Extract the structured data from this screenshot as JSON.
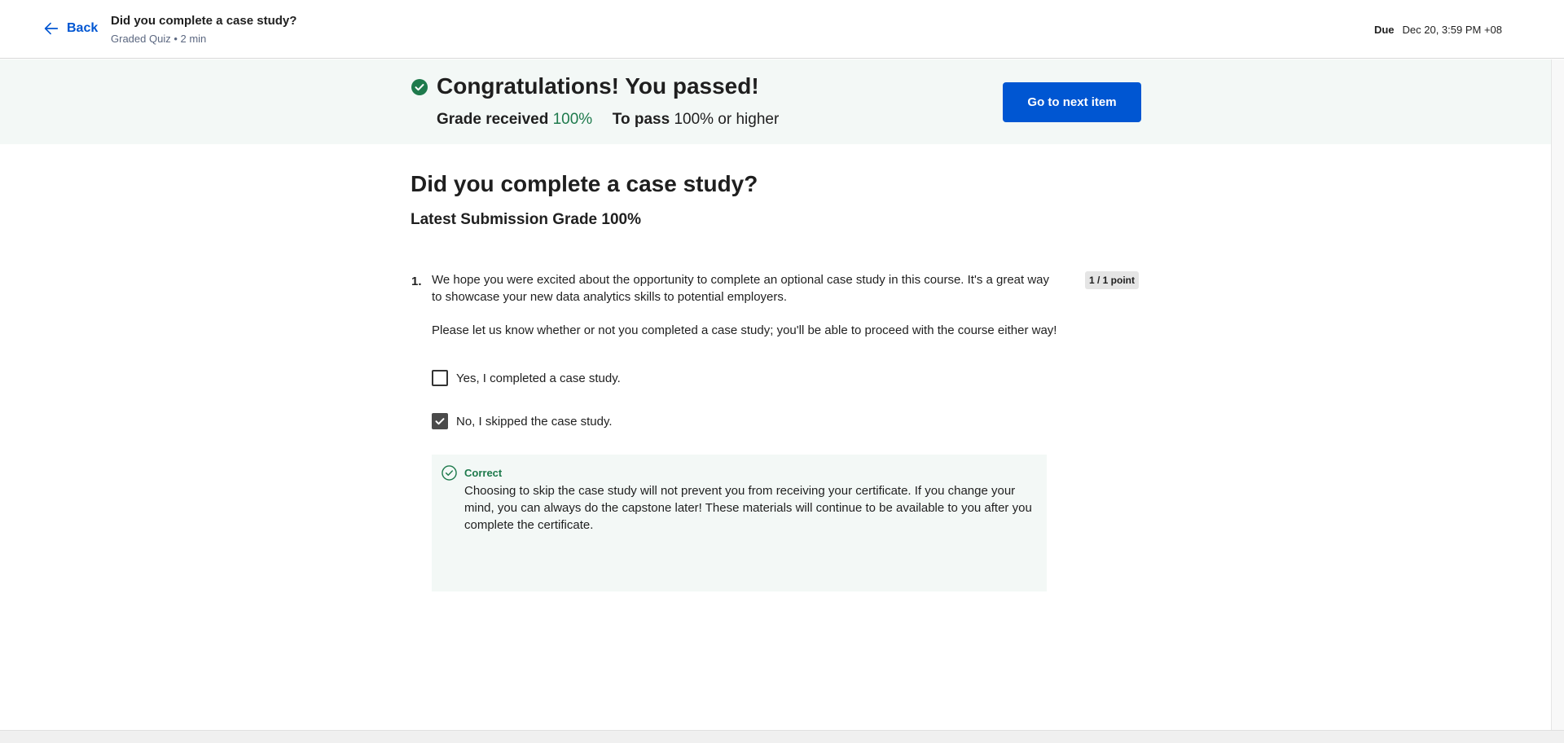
{
  "header": {
    "back_label": "Back",
    "title": "Did you complete a case study?",
    "subtitle": "Graded Quiz • 2 min",
    "due_label": "Due",
    "due_value": "Dec 20, 3:59 PM +08"
  },
  "banner": {
    "title": "Congratulations! You passed!",
    "grade_label": "Grade received",
    "grade_value": "100%",
    "pass_label": "To pass",
    "pass_value": "100% or higher",
    "next_button": "Go to next item",
    "colors": {
      "accent": "#0056d2",
      "success": "#1e7a4c",
      "banner_bg": "#f3f8f6"
    }
  },
  "main": {
    "title": "Did you complete a case study?",
    "latest_grade": "Latest Submission Grade 100%"
  },
  "question": {
    "number": "1.",
    "text": "We hope you were excited about the opportunity to complete an optional case study in this course. It's a great way to showcase your new data analytics skills to potential employers.",
    "text2": "Please let us know whether or not you completed a case study; you'll be able to proceed with the course either way!",
    "points": "1 / 1 point",
    "options": [
      {
        "label": "Yes, I completed a case study.",
        "checked": false
      },
      {
        "label": "No, I skipped the case study.",
        "checked": true
      }
    ],
    "feedback": {
      "label": "Correct",
      "text": "Choosing to skip the case study will not prevent you from receiving your certificate. If you change your mind, you can always do the capstone later! These materials will continue to be available to you after you complete the certificate."
    }
  }
}
